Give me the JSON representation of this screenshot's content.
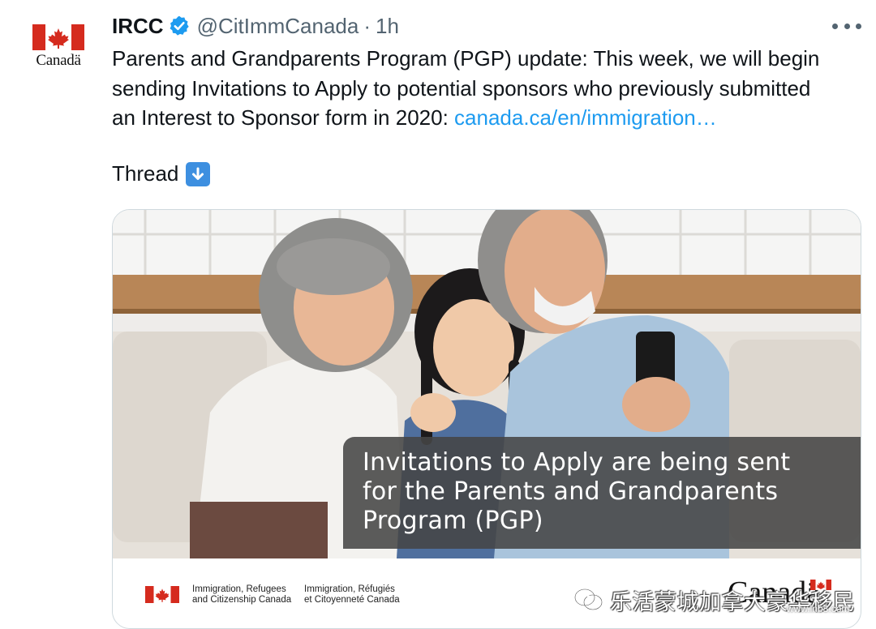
{
  "account": {
    "avatar_wordmark": "Canadä",
    "display_name": "IRCC",
    "handle": "@CitImmCanada",
    "separator": "·",
    "time": "1h"
  },
  "tweet": {
    "line1": "Parents and Grandparents Program (PGP) update: This week, we will begin",
    "line2": "sending Invitations to Apply to potential sponsors who previously submitted",
    "line3_prefix": "an Interest to Sponsor form in 2020: ",
    "link": "canada.ca/en/immigration…",
    "thread_label": "Thread"
  },
  "media": {
    "overlay_line1": "Invitations to Apply are being sent",
    "overlay_line2": "for the Parents and Grandparents",
    "overlay_line3": "Program (PGP)",
    "dept_en_line1": "Immigration, Refugees",
    "dept_en_line2": "and Citizenship Canada",
    "dept_fr_line1": "Immigration, Réfugiés",
    "dept_fr_line2": "et Citoyenneté Canada",
    "wordmark": "Canadä"
  },
  "watermark": {
    "text": "乐活蒙城加拿大豪华移民",
    "url": "www.lnb8.com"
  },
  "colors": {
    "link": "#1d9bf0",
    "verified": "#1d9bf0",
    "canada_red": "#d52b1e",
    "secondary_text": "#536471"
  },
  "icons": [
    "maple-leaf-flag-icon",
    "verified-badge-icon",
    "more-options-icon",
    "down-arrow-emoji-icon",
    "wechat-icon"
  ]
}
